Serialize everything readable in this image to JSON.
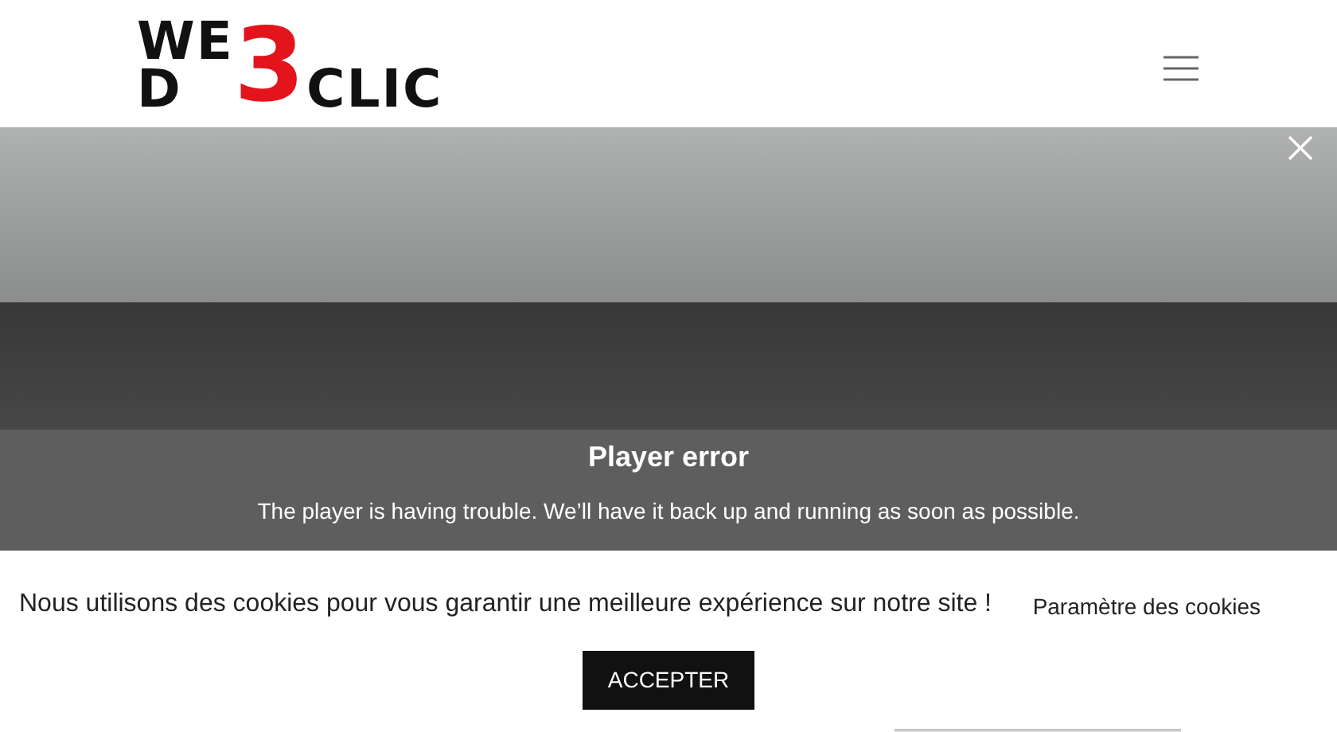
{
  "logo": {
    "top": "WE",
    "mark": "3",
    "bottom_left": "D",
    "bottom_right": "CLIC"
  },
  "player": {
    "title": "Player error",
    "message": "The player is having trouble. We’ll have it back up and running as soon as possible."
  },
  "cookie_banner": {
    "message": "Nous utilisons des cookies pour vous garantir une meilleure expérience sur notre site !",
    "settings_link": "Paramètre des cookies",
    "accept_button": "ACCEPTER"
  }
}
